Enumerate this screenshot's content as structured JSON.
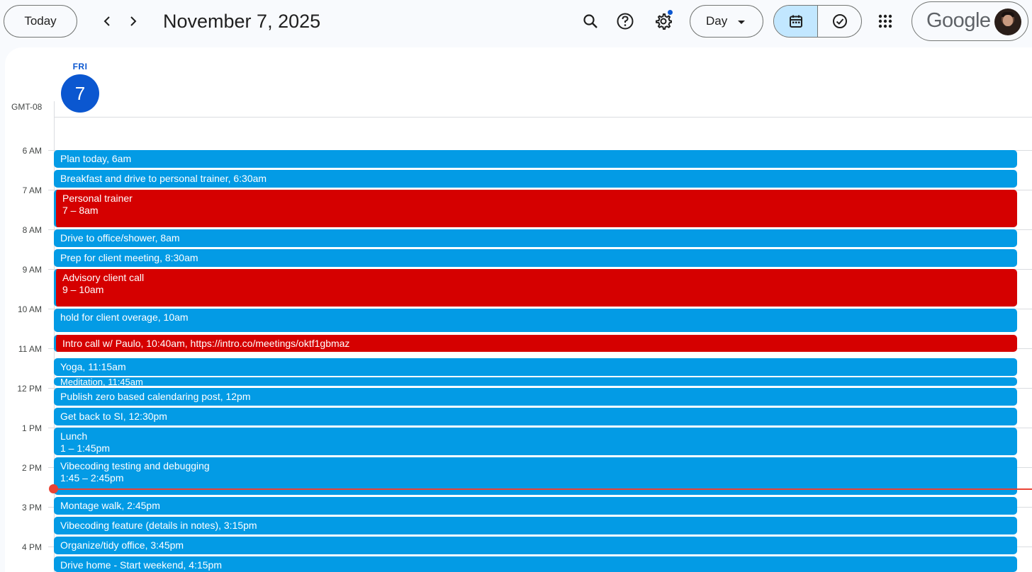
{
  "header": {
    "today_label": "Today",
    "date_title": "November 7, 2025",
    "view_label": "Day",
    "logo_text": "Google",
    "icons": [
      "chevron-left-icon",
      "chevron-right-icon",
      "search-icon",
      "help-icon",
      "settings-icon",
      "calendar-icon",
      "tasks-check-icon",
      "apps-grid-icon"
    ]
  },
  "day": {
    "timezone": "GMT-08",
    "weekday": "FRI",
    "number": "7"
  },
  "hours": [
    "6 AM",
    "7 AM",
    "8 AM",
    "9 AM",
    "10 AM",
    "11 AM",
    "12 PM",
    "1 PM",
    "2 PM",
    "3 PM",
    "4 PM"
  ],
  "events": [
    {
      "title": "Plan today, 6am",
      "time": "",
      "color": "blue"
    },
    {
      "title": "Breakfast and drive to personal trainer, 6:30am",
      "time": "",
      "color": "blue"
    },
    {
      "title": "Personal trainer",
      "time": "7 – 8am",
      "color": "red"
    },
    {
      "title": "Drive to office/shower, 8am",
      "time": "",
      "color": "blue"
    },
    {
      "title": "Prep for client meeting, 8:30am",
      "time": "",
      "color": "blue"
    },
    {
      "title": "Advisory client call",
      "time": "9 – 10am",
      "color": "red"
    },
    {
      "title": "hold for client overage, 10am",
      "time": "",
      "color": "blue"
    },
    {
      "title": "Intro call w/ Paulo, 10:40am, https://intro.co/meetings/oktf1gbmaz",
      "time": "",
      "color": "red"
    },
    {
      "title": "Yoga, 11:15am",
      "time": "",
      "color": "blue"
    },
    {
      "title": "Meditation, 11:45am",
      "time": "",
      "color": "blue"
    },
    {
      "title": "Publish zero based calendaring post, 12pm",
      "time": "",
      "color": "blue"
    },
    {
      "title": "Get back to SI, 12:30pm",
      "time": "",
      "color": "blue"
    },
    {
      "title": "Lunch",
      "time": "1 – 1:45pm",
      "color": "blue"
    },
    {
      "title": "Vibecoding testing and debugging",
      "time": "1:45 – 2:45pm",
      "color": "blue"
    },
    {
      "title": "Montage walk, 2:45pm",
      "time": "",
      "color": "blue"
    },
    {
      "title": "Vibecoding feature (details in notes), 3:15pm",
      "time": "",
      "color": "blue"
    },
    {
      "title": "Organize/tidy office, 3:45pm",
      "time": "",
      "color": "blue"
    },
    {
      "title": "Drive home - Start weekend, 4:15pm",
      "time": "",
      "color": "blue"
    }
  ],
  "colors": {
    "blue": "#039be5",
    "red": "#d50000",
    "accent": "#0b57d0",
    "now": "#ea4335"
  }
}
